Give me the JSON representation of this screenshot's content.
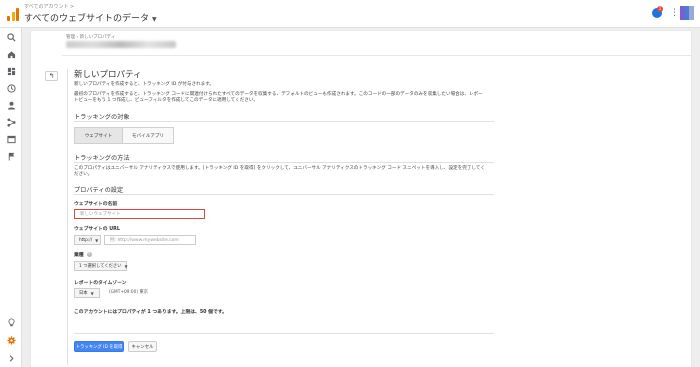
{
  "header": {
    "breadcrumb": "すべてのアカウント > ",
    "account_title": "すべてのウェブサイトのデータ",
    "notification_count": "1"
  },
  "sidebar": {
    "icons": [
      "search-icon",
      "home-icon",
      "dashboard-icon",
      "clock-icon",
      "person-icon",
      "acquisition-icon",
      "behavior-icon",
      "flag-icon",
      "lightbulb-icon",
      "gear-icon",
      "chevron-right-icon"
    ]
  },
  "page": {
    "breadcrumb": "管理 › 新しいプロパティ",
    "title": "新しいプロパティ",
    "intro1": "新しいプロパティを作成すると、トラッキング ID が付与されます。",
    "intro2a": "最初のプロパティを作成すると、トラッキング コードに関連付けられたすべてのデータを収集する、デフォルトのビューも作成されます。このコードの一部のデータのみを収集したい場合は、レポー",
    "intro2b": "トビューをもう 1 つ作成し、ビューフィルタを作成してこのデータに適用してください。",
    "tracking_target_heading": "トラッキングの対象",
    "tab_website": "ウェブサイト",
    "tab_mobile": "モバイルアプリ",
    "tracking_method_heading": "トラッキングの方法",
    "method_text_a": "このプロパティはユニバーサル アナリティクスで使用します。[トラッキング ID を取得] をクリックして、ユニバーサル アナリティクスのトラッキング コード スニペットを導入し、設定を完了してく",
    "method_text_b": "ださい。",
    "property_settings_heading": "プロパティの設定",
    "website_name_label": "ウェブサイトの名前",
    "website_name_placeholder": "新しいウェブサイト",
    "website_url_label": "ウェブサイトの URL",
    "protocol_value": "http://",
    "url_placeholder": "例: http://www.mywebsite.com",
    "industry_label": "業種",
    "industry_value": "1 つ選択してください",
    "timezone_label": "レポートのタイムゾーン",
    "country_value": "日本",
    "timezone_value": "(GMT+09:00) 東京",
    "property_count_text": "このアカウントにはプロパティが 1 つあります。上限は、50 個です。",
    "get_tracking_id_button": "トラッキング ID を取得",
    "cancel_button": "キャンセル"
  },
  "colors": {
    "primary_button": "#4285f4",
    "error_border": "#d94b3d",
    "gear_accent": "#e37400"
  }
}
